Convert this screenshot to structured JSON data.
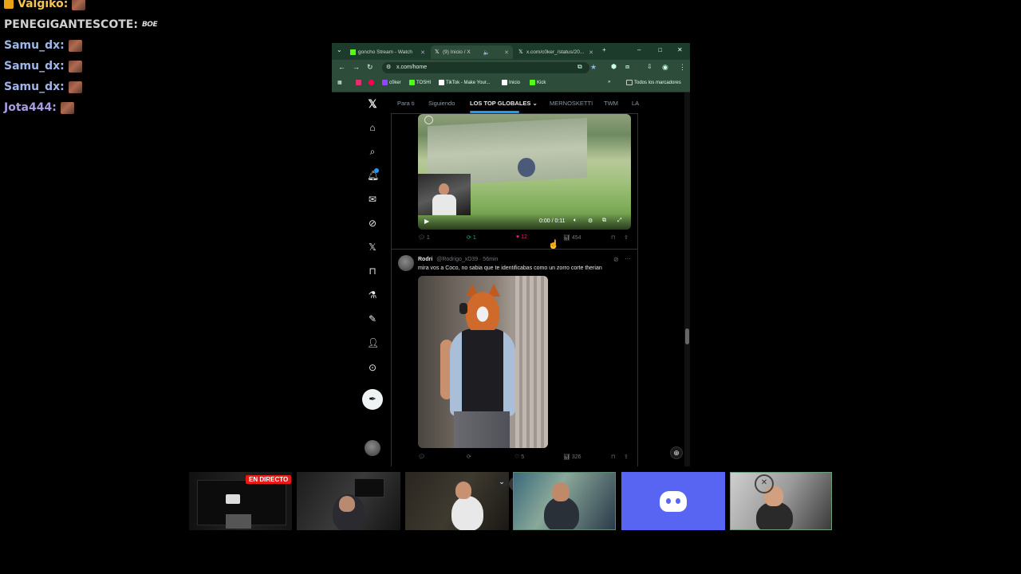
{
  "chat": [
    {
      "user": "Valgiko:",
      "color": "#f6c452",
      "badge": true,
      "emote": "img"
    },
    {
      "user": "PENEGIGANTESCOTE:",
      "color": "#d0d0d0",
      "badge": false,
      "emote": "text",
      "emote_text": "BOE"
    },
    {
      "user": "Samu_dx:",
      "color": "#9fb6e8",
      "badge": false,
      "emote": "img"
    },
    {
      "user": "Samu_dx:",
      "color": "#9fb6e8",
      "badge": false,
      "emote": "img"
    },
    {
      "user": "Samu_dx:",
      "color": "#9fb6e8",
      "badge": false,
      "emote": "img"
    },
    {
      "user": "Jota444:",
      "color": "#a79de0",
      "badge": false,
      "emote": "img"
    }
  ],
  "browser": {
    "tabs": [
      {
        "label": "goncho Stream - Watch",
        "icon": "kick-icon",
        "color": "#53fc18"
      },
      {
        "label": "(9) Inicio / X",
        "icon": "x-icon",
        "color": "#ffffff"
      },
      {
        "label": "x.com/c0ker_/status/20...",
        "icon": "x-icon",
        "color": "#ffffff"
      }
    ],
    "new_tab": "+",
    "window_controls": [
      "–",
      "☐",
      "✕"
    ],
    "url": "x.com/home",
    "bookmarks": [
      {
        "label": "",
        "color": "#e1306c"
      },
      {
        "label": "",
        "color": "#ff0050"
      },
      {
        "label": "c0ker",
        "color": "#9146ff"
      },
      {
        "label": "TOSHI",
        "color": "#53fc18"
      },
      {
        "label": "TikTok - Make Your...",
        "color": "#ffffff"
      },
      {
        "label": "Inicio",
        "color": "#ffffff"
      },
      {
        "label": "Kick",
        "color": "#53fc18"
      }
    ],
    "all_bookmarks": "Todos los marcadores",
    "more": "»"
  },
  "x": {
    "tabs": [
      "Para ti",
      "Siguiendo",
      "LOS TOP GLOBALES",
      "MERNOSKETTI",
      "TWM",
      "LA"
    ],
    "video": {
      "time": "0:00 / 0:11"
    },
    "tweet1_actions": {
      "replies": "1",
      "reposts": "1",
      "likes": "12",
      "views": "454"
    },
    "tweet2": {
      "name": "Rodri",
      "handle": "@Rodrigo_xD39 · 56min",
      "text": "mira vos a Coco, no sabia que te identificabas como un zorro corte therian",
      "actions": {
        "replies": "",
        "reposts": "",
        "likes": "5",
        "views": "326"
      }
    }
  },
  "streams": {
    "live_label": "EN DIRECTO"
  },
  "colors": {
    "accent": "#1d9bf0",
    "like": "#f91880",
    "repost": "#00ba7c",
    "discord": "#5865f2",
    "live": "#e91916"
  }
}
